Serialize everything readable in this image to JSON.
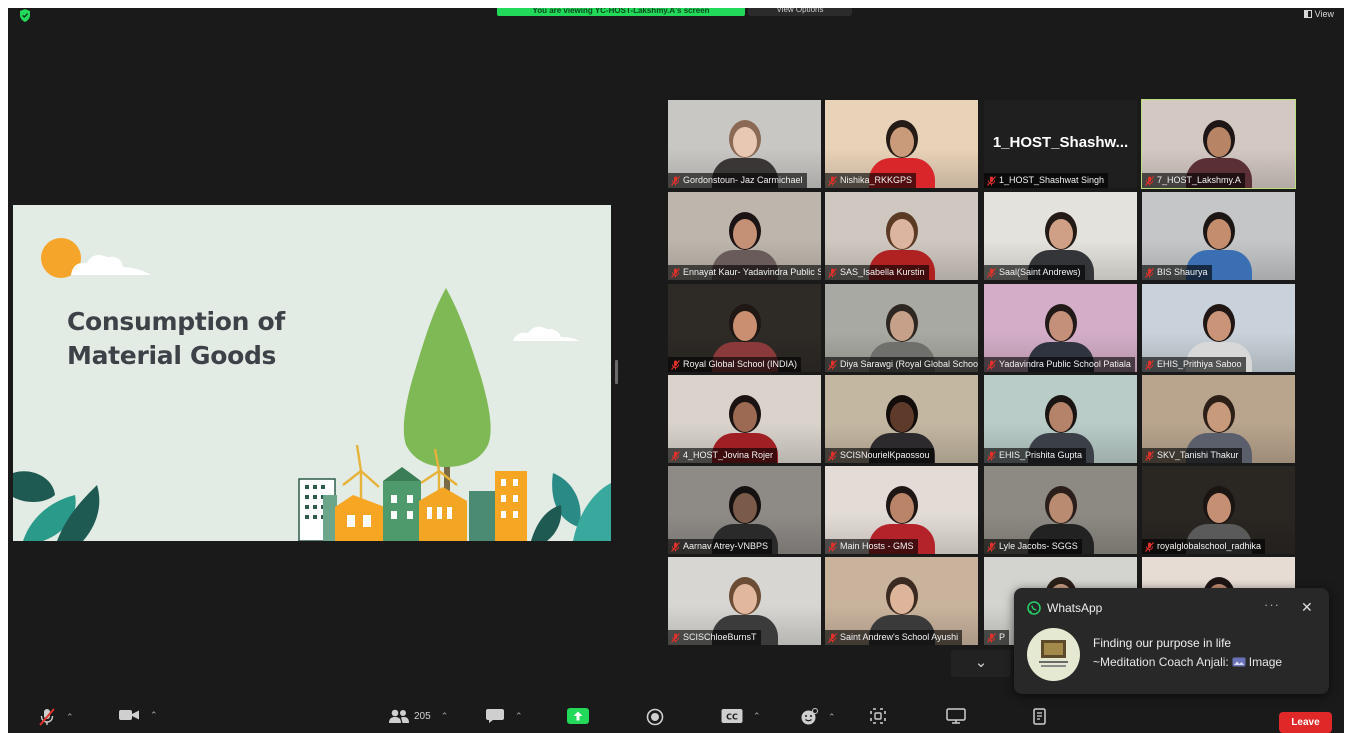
{
  "topbar": {
    "share_banner": "You are viewing YC-HOST-Lakshmy.A's screen",
    "view_options": "View Options",
    "view_label": "View"
  },
  "slide": {
    "title_line1": "Consumption of",
    "title_line2": "Material Goods"
  },
  "participants": [
    {
      "name": "Gordonstoun- Jaz Carmichael",
      "bg": "#c9c7c4",
      "skin": "#e8c7b3",
      "hair": "#8a6a55",
      "shirt": "#3a3636"
    },
    {
      "name": "Nishika_RKKGPS",
      "bg": "#e8d2b8",
      "skin": "#c99b7a",
      "hair": "#241b16",
      "shirt": "#d9262a"
    },
    {
      "name": "1_HOST_Shashwat Singh",
      "display": "1_HOST_Shashw...",
      "video_off": true
    },
    {
      "name": "7_HOST_Lakshmy.A",
      "bg": "#d3c8c2",
      "skin": "#b88466",
      "hair": "#1e1616",
      "shirt": "#5a2f35",
      "active": true
    },
    {
      "name": "Ennayat Kaur- Yadavindra Public School",
      "bg": "#bdb6ad",
      "skin": "#c49076",
      "hair": "#1c1414",
      "shirt": "#6a5b5b"
    },
    {
      "name": "SAS_Isabella Kurstin",
      "bg": "#cfc8c0",
      "skin": "#dcb5a0",
      "hair": "#5a3a22",
      "shirt": "#b02222"
    },
    {
      "name": "Saal(Saint Andrews)",
      "bg": "#e4e2dc",
      "skin": "#cfa085",
      "hair": "#231a16",
      "shirt": "#333538"
    },
    {
      "name": "BIS Shaurya",
      "bg": "#c4c6c8",
      "skin": "#c48e6e",
      "hair": "#1b1514",
      "shirt": "#3a6fb4"
    },
    {
      "name": "Royal Global School (INDIA)",
      "bg": "#2e2a26",
      "skin": "#c98f70",
      "hair": "#1e1714",
      "shirt": "#8a3a3a"
    },
    {
      "name": "Diya Sarawgi (Royal Global School)",
      "bg": "#a9a9a3",
      "skin": "#c7a08a",
      "hair": "#2e2620",
      "shirt": "#6f6f6c"
    },
    {
      "name": "Yadavindra Public School Patiala",
      "bg": "#d4aec8",
      "skin": "#c4907a",
      "hair": "#221a18",
      "shirt": "#2f3440"
    },
    {
      "name": "EHIS_Prithiya Saboo",
      "bg": "#c9d2da",
      "skin": "#c99478",
      "hair": "#201715",
      "shirt": "#d8d8d8"
    },
    {
      "name": "4_HOST_Jovina Rojer",
      "bg": "#d9d3cc",
      "skin": "#9c6a52",
      "hair": "#1a1312",
      "shirt": "#9f1f25"
    },
    {
      "name": "SCISNourielKpaossou",
      "bg": "#c4b7a2",
      "skin": "#5e3a2a",
      "hair": "#120c0b",
      "shirt": "#2c2a2c"
    },
    {
      "name": "EHIS_Prishita Gupta",
      "bg": "#b9ccc8",
      "skin": "#b5826a",
      "hair": "#1a1413",
      "shirt": "#3a3f48"
    },
    {
      "name": "SKV_Tanishi Thakur",
      "bg": "#b9a58e",
      "skin": "#c89a7c",
      "hair": "#2c1f18",
      "shirt": "#5a5f6b"
    },
    {
      "name": "Aarnav Atrey-VNBPS",
      "bg": "#8e8a86",
      "skin": "#7a5a48",
      "hair": "#141110",
      "shirt": "#2a2a2a"
    },
    {
      "name": "Main Hosts - GMS",
      "bg": "#e3dcd6",
      "skin": "#b98468",
      "hair": "#1d1615",
      "shirt": "#b4232a"
    },
    {
      "name": "Lyle Jacobs- SGGS",
      "bg": "#8c8a82",
      "skin": "#b98b70",
      "hair": "#2a1f1a",
      "shirt": "#222222"
    },
    {
      "name": "royalglobalschool_radhika",
      "bg": "#2a2622",
      "skin": "#c48f72",
      "hair": "#1a1412",
      "shirt": "#5a5a5a"
    },
    {
      "name": "SCISChloeBurnsT",
      "bg": "#d7d6d2",
      "skin": "#e1b79d",
      "hair": "#6b4c34",
      "shirt": "#3b3b3b"
    },
    {
      "name": "Saint Andrew's School Ayushi",
      "bg": "#c9b39d",
      "skin": "#dcb59a",
      "hair": "#3b2a20",
      "shirt": "#3a3a3a"
    },
    {
      "name": "P",
      "bg": "#d3d3cf",
      "skin": "#cfa287",
      "hair": "#2a2019",
      "shirt": "#4a4a4a"
    },
    {
      "name": "",
      "bg": "#e7dcd4",
      "skin": "#c48e72",
      "hair": "#1c1514",
      "shirt": "#5a5050"
    }
  ],
  "notification": {
    "app": "WhatsApp",
    "more": "···",
    "close": "✕",
    "title": "Finding our purpose in life",
    "body": "~Meditation Coach Anjali:",
    "attachment": "Image"
  },
  "toolbar": {
    "participants_count": "205",
    "leave": "Leave"
  },
  "colors": {
    "share_green": "#23d959",
    "active_speaker": "#b9e07a",
    "leave_red": "#e02828",
    "muted_mic": "#e0312a"
  }
}
